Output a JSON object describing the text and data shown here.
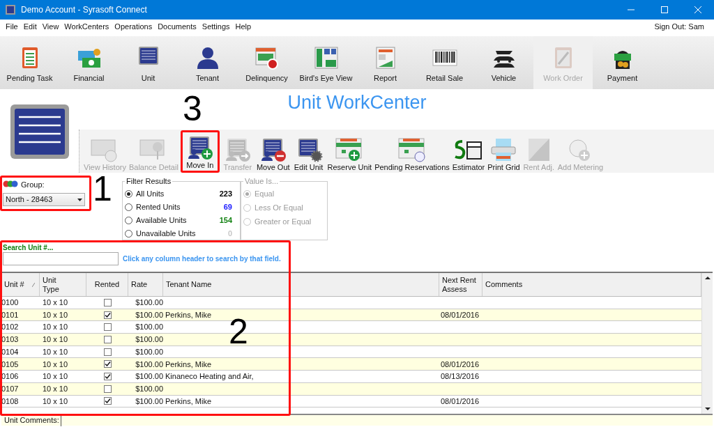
{
  "window": {
    "title": "Demo Account - Syrasoft Connect"
  },
  "menu": [
    "File",
    "Edit",
    "View",
    "WorkCenters",
    "Operations",
    "Documents",
    "Settings",
    "Help"
  ],
  "sign_out": "Sign Out: Sam",
  "nav": [
    {
      "label": "Pending Task",
      "disabled": false
    },
    {
      "label": "Financial",
      "disabled": false
    },
    {
      "label": "Unit",
      "disabled": false
    },
    {
      "label": "Tenant",
      "disabled": false
    },
    {
      "label": "Delinquency",
      "disabled": false
    },
    {
      "label": "Bird's Eye View",
      "disabled": false
    },
    {
      "label": "Report",
      "disabled": false
    },
    {
      "label": "Retail Sale",
      "disabled": false
    },
    {
      "label": "Vehicle",
      "disabled": false
    },
    {
      "label": "Work Order",
      "disabled": true
    },
    {
      "label": "Payment",
      "disabled": false
    }
  ],
  "page_title": "Unit WorkCenter",
  "tools": [
    {
      "label": "View History",
      "disabled": true
    },
    {
      "label": "Balance Detail",
      "disabled": true
    },
    {
      "label": "Move In",
      "disabled": false
    },
    {
      "label": "Transfer",
      "disabled": true
    },
    {
      "label": "Move Out",
      "disabled": false
    },
    {
      "label": "Edit Unit",
      "disabled": false
    },
    {
      "label": "Reserve Unit",
      "disabled": false
    },
    {
      "label": "Pending Reservations",
      "disabled": false
    },
    {
      "label": "Estimator",
      "disabled": false
    },
    {
      "label": "Print Grid",
      "disabled": false
    },
    {
      "label": "Rent Adj.",
      "disabled": true
    },
    {
      "label": "Add Metering",
      "disabled": true
    }
  ],
  "group": {
    "label": "Group:",
    "value": "North - 28463"
  },
  "filter_results": {
    "title": "Filter Results",
    "options": [
      {
        "label": "All Units",
        "count": "223",
        "color": "#000000",
        "selected": true
      },
      {
        "label": "Rented Units",
        "count": "69",
        "color": "#1a1aff",
        "selected": false
      },
      {
        "label": "Available Units",
        "count": "154",
        "color": "#108010",
        "selected": false
      },
      {
        "label": "Unavailable Units",
        "count": "0",
        "color": "#c8c8c8",
        "selected": false
      }
    ]
  },
  "value_is": {
    "title": "Value Is...",
    "disabled": true,
    "options": [
      {
        "label": "Equal",
        "selected": true
      },
      {
        "label": "Less Or Equal",
        "selected": false
      },
      {
        "label": "Greater or Equal",
        "selected": false
      }
    ]
  },
  "search": {
    "label": "Search Unit #...",
    "hint": "Click any column header to search by that field."
  },
  "table": {
    "columns": [
      "Unit #",
      "Unit Type",
      "Rented",
      "Rate",
      "Tenant Name",
      "Next Rent Assess",
      "Comments"
    ],
    "rows": [
      {
        "unit": "0100",
        "type": "10 x 10",
        "rented": false,
        "rate": "$100.00"
      },
      {
        "unit": "0101",
        "type": "10 x 10",
        "rented": true,
        "rate": "$100.00",
        "tenant": "Perkins, Mike",
        "next_rent": "08/01/2016"
      },
      {
        "unit": "0102",
        "type": "10 x 10",
        "rented": false,
        "rate": "$100.00"
      },
      {
        "unit": "0103",
        "type": "10 x 10",
        "rented": false,
        "rate": "$100.00"
      },
      {
        "unit": "0104",
        "type": "10 x 10",
        "rented": false,
        "rate": "$100.00"
      },
      {
        "unit": "0105",
        "type": "10 x 10",
        "rented": true,
        "rate": "$100.00",
        "tenant": "Perkins, Mike",
        "next_rent": "08/01/2016"
      },
      {
        "unit": "0106",
        "type": "10 x 10",
        "rented": true,
        "rate": "$100.00",
        "tenant": "Kinaneco Heating and Air,",
        "next_rent": "08/13/2016"
      },
      {
        "unit": "0107",
        "type": "10 x 10",
        "rented": false,
        "rate": "$100.00"
      },
      {
        "unit": "0108",
        "type": "10 x 10",
        "rented": true,
        "rate": "$100.00",
        "tenant": "Perkins, Mike",
        "next_rent": "08/01/2016"
      }
    ]
  },
  "status_bar": {
    "label": "Unit Comments:"
  },
  "annotations": [
    {
      "label": "1"
    },
    {
      "label": "2"
    },
    {
      "label": "3"
    }
  ]
}
